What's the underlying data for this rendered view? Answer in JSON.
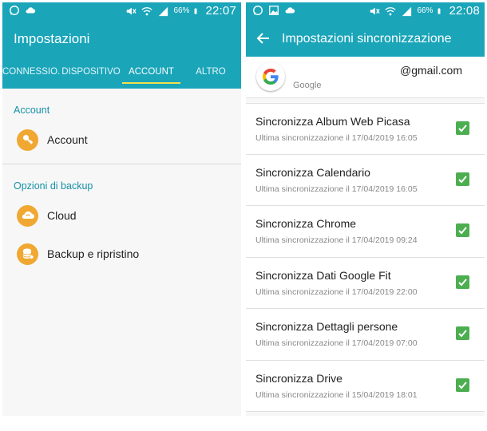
{
  "colors": {
    "teal": "#1aa5b9",
    "tab_indicator": "#f4e04d",
    "section_header": "#1591a6",
    "icon_orange": "#f0a832",
    "check_green": "#4cae50"
  },
  "left": {
    "status": {
      "battery": "66%",
      "time": "22:07",
      "icons": [
        "whatsapp-icon",
        "cloud-icon",
        "mute-icon",
        "wifi-icon",
        "signal-icon",
        "battery-icon"
      ]
    },
    "title": "Impostazioni",
    "tabs": [
      {
        "label": "CONNESSIO..",
        "active": false
      },
      {
        "label": "DISPOSITIVO",
        "active": false
      },
      {
        "label": "ACCOUNT",
        "active": true
      },
      {
        "label": "ALTRO",
        "active": false
      }
    ],
    "sections": [
      {
        "header": "Account",
        "items": [
          {
            "label": "Account",
            "icon": "key-icon"
          }
        ]
      },
      {
        "header": "Opzioni di backup",
        "items": [
          {
            "label": "Cloud",
            "icon": "cloud-sync-icon"
          },
          {
            "label": "Backup e ripristino",
            "icon": "database-icon"
          }
        ]
      }
    ]
  },
  "right": {
    "status": {
      "battery": "66%",
      "time": "22:08",
      "icons": [
        "whatsapp-icon",
        "image-icon",
        "cloud-icon",
        "mute-icon",
        "wifi-icon",
        "signal-icon",
        "battery-icon"
      ]
    },
    "title": "Impostazioni sincronizzazione",
    "account": {
      "email": "@gmail.com",
      "provider": "Google"
    },
    "sync_items": [
      {
        "title": "Sincronizza Album Web Picasa",
        "subtitle": "Ultima sincronizzazione il 17/04/2019 16:05",
        "checked": true
      },
      {
        "title": "Sincronizza Calendario",
        "subtitle": "Ultima sincronizzazione il 17/04/2019 16:05",
        "checked": true
      },
      {
        "title": "Sincronizza Chrome",
        "subtitle": "Ultima sincronizzazione il 17/04/2019 09:24",
        "checked": true
      },
      {
        "title": "Sincronizza Dati Google Fit",
        "subtitle": "Ultima sincronizzazione il 17/04/2019 22:00",
        "checked": true
      },
      {
        "title": "Sincronizza Dettagli persone",
        "subtitle": "Ultima sincronizzazione il 17/04/2019 07:00",
        "checked": true
      },
      {
        "title": "Sincronizza Drive",
        "subtitle": "Ultima sincronizzazione il 15/04/2019 18:01",
        "checked": true
      }
    ]
  }
}
